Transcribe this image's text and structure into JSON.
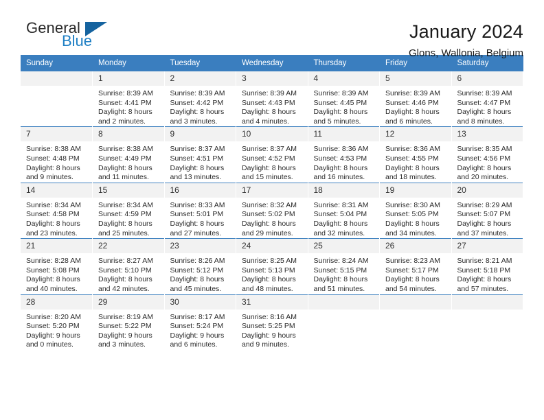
{
  "brand": {
    "name_part1": "General",
    "name_part2": "Blue",
    "triangle_icon": "blue-triangle-icon",
    "color_dark": "#2b2b2b",
    "color_blue": "#1e7fc4"
  },
  "header": {
    "title": "January 2024",
    "subtitle": "Glons, Wallonia, Belgium"
  },
  "theme": {
    "header_bg": "#3a7ebf",
    "header_text": "#ffffff",
    "daynum_bg": "#f2f2f2",
    "cell_text": "#2a2a2a"
  },
  "calendar": {
    "weekday_headers": [
      "Sunday",
      "Monday",
      "Tuesday",
      "Wednesday",
      "Thursday",
      "Friday",
      "Saturday"
    ],
    "weeks": [
      [
        {
          "day": "",
          "sunrise": "",
          "sunset": "",
          "daylight_line1": "",
          "daylight_line2": "",
          "empty": true
        },
        {
          "day": "1",
          "sunrise": "Sunrise: 8:39 AM",
          "sunset": "Sunset: 4:41 PM",
          "daylight_line1": "Daylight: 8 hours",
          "daylight_line2": "and 2 minutes.",
          "empty": false
        },
        {
          "day": "2",
          "sunrise": "Sunrise: 8:39 AM",
          "sunset": "Sunset: 4:42 PM",
          "daylight_line1": "Daylight: 8 hours",
          "daylight_line2": "and 3 minutes.",
          "empty": false
        },
        {
          "day": "3",
          "sunrise": "Sunrise: 8:39 AM",
          "sunset": "Sunset: 4:43 PM",
          "daylight_line1": "Daylight: 8 hours",
          "daylight_line2": "and 4 minutes.",
          "empty": false
        },
        {
          "day": "4",
          "sunrise": "Sunrise: 8:39 AM",
          "sunset": "Sunset: 4:45 PM",
          "daylight_line1": "Daylight: 8 hours",
          "daylight_line2": "and 5 minutes.",
          "empty": false
        },
        {
          "day": "5",
          "sunrise": "Sunrise: 8:39 AM",
          "sunset": "Sunset: 4:46 PM",
          "daylight_line1": "Daylight: 8 hours",
          "daylight_line2": "and 6 minutes.",
          "empty": false
        },
        {
          "day": "6",
          "sunrise": "Sunrise: 8:39 AM",
          "sunset": "Sunset: 4:47 PM",
          "daylight_line1": "Daylight: 8 hours",
          "daylight_line2": "and 8 minutes.",
          "empty": false
        }
      ],
      [
        {
          "day": "7",
          "sunrise": "Sunrise: 8:38 AM",
          "sunset": "Sunset: 4:48 PM",
          "daylight_line1": "Daylight: 8 hours",
          "daylight_line2": "and 9 minutes.",
          "empty": false
        },
        {
          "day": "8",
          "sunrise": "Sunrise: 8:38 AM",
          "sunset": "Sunset: 4:49 PM",
          "daylight_line1": "Daylight: 8 hours",
          "daylight_line2": "and 11 minutes.",
          "empty": false
        },
        {
          "day": "9",
          "sunrise": "Sunrise: 8:37 AM",
          "sunset": "Sunset: 4:51 PM",
          "daylight_line1": "Daylight: 8 hours",
          "daylight_line2": "and 13 minutes.",
          "empty": false
        },
        {
          "day": "10",
          "sunrise": "Sunrise: 8:37 AM",
          "sunset": "Sunset: 4:52 PM",
          "daylight_line1": "Daylight: 8 hours",
          "daylight_line2": "and 15 minutes.",
          "empty": false
        },
        {
          "day": "11",
          "sunrise": "Sunrise: 8:36 AM",
          "sunset": "Sunset: 4:53 PM",
          "daylight_line1": "Daylight: 8 hours",
          "daylight_line2": "and 16 minutes.",
          "empty": false
        },
        {
          "day": "12",
          "sunrise": "Sunrise: 8:36 AM",
          "sunset": "Sunset: 4:55 PM",
          "daylight_line1": "Daylight: 8 hours",
          "daylight_line2": "and 18 minutes.",
          "empty": false
        },
        {
          "day": "13",
          "sunrise": "Sunrise: 8:35 AM",
          "sunset": "Sunset: 4:56 PM",
          "daylight_line1": "Daylight: 8 hours",
          "daylight_line2": "and 20 minutes.",
          "empty": false
        }
      ],
      [
        {
          "day": "14",
          "sunrise": "Sunrise: 8:34 AM",
          "sunset": "Sunset: 4:58 PM",
          "daylight_line1": "Daylight: 8 hours",
          "daylight_line2": "and 23 minutes.",
          "empty": false
        },
        {
          "day": "15",
          "sunrise": "Sunrise: 8:34 AM",
          "sunset": "Sunset: 4:59 PM",
          "daylight_line1": "Daylight: 8 hours",
          "daylight_line2": "and 25 minutes.",
          "empty": false
        },
        {
          "day": "16",
          "sunrise": "Sunrise: 8:33 AM",
          "sunset": "Sunset: 5:01 PM",
          "daylight_line1": "Daylight: 8 hours",
          "daylight_line2": "and 27 minutes.",
          "empty": false
        },
        {
          "day": "17",
          "sunrise": "Sunrise: 8:32 AM",
          "sunset": "Sunset: 5:02 PM",
          "daylight_line1": "Daylight: 8 hours",
          "daylight_line2": "and 29 minutes.",
          "empty": false
        },
        {
          "day": "18",
          "sunrise": "Sunrise: 8:31 AM",
          "sunset": "Sunset: 5:04 PM",
          "daylight_line1": "Daylight: 8 hours",
          "daylight_line2": "and 32 minutes.",
          "empty": false
        },
        {
          "day": "19",
          "sunrise": "Sunrise: 8:30 AM",
          "sunset": "Sunset: 5:05 PM",
          "daylight_line1": "Daylight: 8 hours",
          "daylight_line2": "and 34 minutes.",
          "empty": false
        },
        {
          "day": "20",
          "sunrise": "Sunrise: 8:29 AM",
          "sunset": "Sunset: 5:07 PM",
          "daylight_line1": "Daylight: 8 hours",
          "daylight_line2": "and 37 minutes.",
          "empty": false
        }
      ],
      [
        {
          "day": "21",
          "sunrise": "Sunrise: 8:28 AM",
          "sunset": "Sunset: 5:08 PM",
          "daylight_line1": "Daylight: 8 hours",
          "daylight_line2": "and 40 minutes.",
          "empty": false
        },
        {
          "day": "22",
          "sunrise": "Sunrise: 8:27 AM",
          "sunset": "Sunset: 5:10 PM",
          "daylight_line1": "Daylight: 8 hours",
          "daylight_line2": "and 42 minutes.",
          "empty": false
        },
        {
          "day": "23",
          "sunrise": "Sunrise: 8:26 AM",
          "sunset": "Sunset: 5:12 PM",
          "daylight_line1": "Daylight: 8 hours",
          "daylight_line2": "and 45 minutes.",
          "empty": false
        },
        {
          "day": "24",
          "sunrise": "Sunrise: 8:25 AM",
          "sunset": "Sunset: 5:13 PM",
          "daylight_line1": "Daylight: 8 hours",
          "daylight_line2": "and 48 minutes.",
          "empty": false
        },
        {
          "day": "25",
          "sunrise": "Sunrise: 8:24 AM",
          "sunset": "Sunset: 5:15 PM",
          "daylight_line1": "Daylight: 8 hours",
          "daylight_line2": "and 51 minutes.",
          "empty": false
        },
        {
          "day": "26",
          "sunrise": "Sunrise: 8:23 AM",
          "sunset": "Sunset: 5:17 PM",
          "daylight_line1": "Daylight: 8 hours",
          "daylight_line2": "and 54 minutes.",
          "empty": false
        },
        {
          "day": "27",
          "sunrise": "Sunrise: 8:21 AM",
          "sunset": "Sunset: 5:18 PM",
          "daylight_line1": "Daylight: 8 hours",
          "daylight_line2": "and 57 minutes.",
          "empty": false
        }
      ],
      [
        {
          "day": "28",
          "sunrise": "Sunrise: 8:20 AM",
          "sunset": "Sunset: 5:20 PM",
          "daylight_line1": "Daylight: 9 hours",
          "daylight_line2": "and 0 minutes.",
          "empty": false
        },
        {
          "day": "29",
          "sunrise": "Sunrise: 8:19 AM",
          "sunset": "Sunset: 5:22 PM",
          "daylight_line1": "Daylight: 9 hours",
          "daylight_line2": "and 3 minutes.",
          "empty": false
        },
        {
          "day": "30",
          "sunrise": "Sunrise: 8:17 AM",
          "sunset": "Sunset: 5:24 PM",
          "daylight_line1": "Daylight: 9 hours",
          "daylight_line2": "and 6 minutes.",
          "empty": false
        },
        {
          "day": "31",
          "sunrise": "Sunrise: 8:16 AM",
          "sunset": "Sunset: 5:25 PM",
          "daylight_line1": "Daylight: 9 hours",
          "daylight_line2": "and 9 minutes.",
          "empty": false
        },
        {
          "day": "",
          "sunrise": "",
          "sunset": "",
          "daylight_line1": "",
          "daylight_line2": "",
          "empty": true
        },
        {
          "day": "",
          "sunrise": "",
          "sunset": "",
          "daylight_line1": "",
          "daylight_line2": "",
          "empty": true
        },
        {
          "day": "",
          "sunrise": "",
          "sunset": "",
          "daylight_line1": "",
          "daylight_line2": "",
          "empty": true
        }
      ]
    ]
  }
}
